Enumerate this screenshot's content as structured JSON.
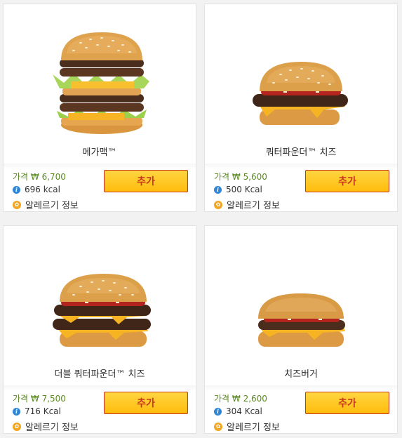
{
  "products": [
    {
      "name": "메가맥™",
      "price": "가격 ₩ 6,700",
      "kcal": "696 kcal",
      "allergy_label": "알레르기 정보",
      "add_label": "추가"
    },
    {
      "name": "쿼터파운더™ 치즈",
      "price": "가격 ₩ 5,600",
      "kcal": "500 Kcal",
      "allergy_label": "알레르기 정보",
      "add_label": "추가"
    },
    {
      "name": "더블 쿼터파운더™ 치즈",
      "price": "가격 ₩ 7,500",
      "kcal": "716 Kcal",
      "allergy_label": "알레르기 정보",
      "add_label": "추가"
    },
    {
      "name": "치즈버거",
      "price": "가격 ₩ 2,600",
      "kcal": "304 Kcal",
      "allergy_label": "알레르기 정보",
      "add_label": "추가"
    }
  ],
  "icons": {
    "info": "info-icon",
    "allergy": "allergy-icon"
  },
  "colors": {
    "price_green": "#5a8a22",
    "button_yellow": "#ffbc0d",
    "button_text_red": "#c8351e",
    "info_blue": "#2f86d8",
    "allergy_orange": "#f2a623"
  }
}
